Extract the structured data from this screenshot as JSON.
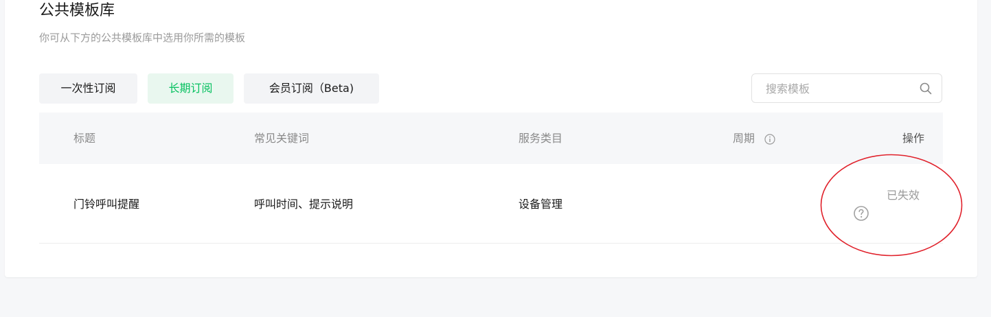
{
  "header": {
    "title": "公共模板库",
    "subtitle": "你可从下方的公共模板库中选用你所需的模板"
  },
  "tabs": [
    {
      "label": "一次性订阅",
      "active": false
    },
    {
      "label": "长期订阅",
      "active": true
    },
    {
      "label": "会员订阅（Beta)",
      "active": false
    }
  ],
  "search": {
    "placeholder": "搜索模板",
    "value": ""
  },
  "table": {
    "columns": [
      "标题",
      "常见关键词",
      "服务类目",
      "周期",
      "操作"
    ],
    "rows": [
      {
        "title": "门铃呼叫提醒",
        "keywords": "呼叫时间、提示说明",
        "category": "设备管理",
        "period": "",
        "action": "已失效"
      }
    ]
  },
  "colors": {
    "accent": "#07c160",
    "annotation": "#e0202a"
  },
  "icons": {
    "search": "search-icon",
    "info": "info-icon",
    "help": "question-circle-icon"
  }
}
